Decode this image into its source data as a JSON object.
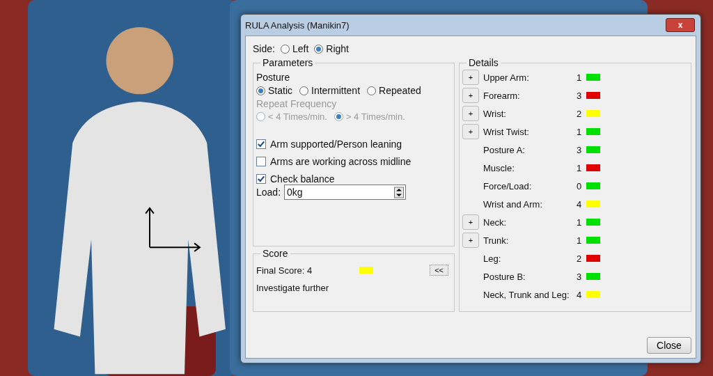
{
  "window": {
    "title": "RULA Analysis (Manikin7)",
    "close_label": "x"
  },
  "side": {
    "label": "Side:",
    "options": [
      {
        "label": "Left",
        "selected": false
      },
      {
        "label": "Right",
        "selected": true
      }
    ]
  },
  "parameters": {
    "title": "Parameters",
    "posture_label": "Posture",
    "posture_options": [
      {
        "label": "Static",
        "selected": true
      },
      {
        "label": "Intermittent",
        "selected": false
      },
      {
        "label": "Repeated",
        "selected": false
      }
    ],
    "frequency_label": "Repeat Frequency",
    "frequency_disabled": true,
    "frequency_options": [
      {
        "label": "< 4 Times/min.",
        "selected": false
      },
      {
        "label": "> 4 Times/min.",
        "selected": true
      }
    ],
    "checkboxes": [
      {
        "label": "Arm supported/Person leaning",
        "checked": true
      },
      {
        "label": "Arms are working across midline",
        "checked": false
      },
      {
        "label": "Check balance",
        "checked": true
      }
    ],
    "load": {
      "label": "Load:",
      "value": "0kg"
    }
  },
  "score": {
    "title": "Score",
    "final_label": "Final Score: 4",
    "color": "#ffff00",
    "result": "Investigate further",
    "toggle_button": "<<"
  },
  "details": {
    "title": "Details",
    "items": [
      {
        "button": "+",
        "label": "Upper Arm:",
        "value": "1",
        "color": "#00e000"
      },
      {
        "button": "+",
        "label": "Forearm:",
        "value": "3",
        "color": "#e00000"
      },
      {
        "button": "+",
        "label": "Wrist:",
        "value": "2",
        "color": "#ffff00"
      },
      {
        "button": "+",
        "label": "Wrist Twist:",
        "value": "1",
        "color": "#00e000"
      },
      {
        "label": "Posture A:",
        "value": "3",
        "color": "#00e000"
      },
      {
        "label": "Muscle:",
        "value": "1",
        "color": "#e00000"
      },
      {
        "label": "Force/Load:",
        "value": "0",
        "color": "#00e000"
      },
      {
        "label": "Wrist and Arm:",
        "value": "4",
        "color": "#ffff00"
      },
      {
        "button": "+",
        "label": "Neck:",
        "value": "1",
        "color": "#00e000"
      },
      {
        "button": "+",
        "label": "Trunk:",
        "value": "1",
        "color": "#00e000"
      },
      {
        "label": "Leg:",
        "value": "2",
        "color": "#e00000"
      },
      {
        "label": "Posture B:",
        "value": "3",
        "color": "#00e000"
      },
      {
        "label": "Neck, Trunk and Leg:",
        "value": "4",
        "color": "#ffff00"
      }
    ]
  },
  "buttons": [
    "Close"
  ]
}
